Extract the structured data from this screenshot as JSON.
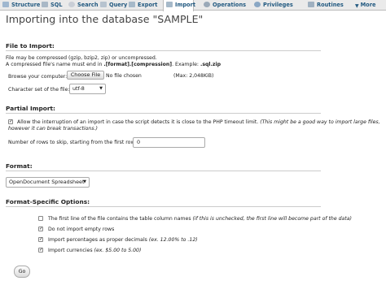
{
  "tabs": [
    {
      "label": "Structure",
      "icon": "structure-icon"
    },
    {
      "label": "SQL",
      "icon": "sql-icon"
    },
    {
      "label": "Search",
      "icon": "search-icon"
    },
    {
      "label": "Query",
      "icon": "query-icon"
    },
    {
      "label": "Export",
      "icon": "export-icon"
    },
    {
      "label": "Import",
      "icon": "import-icon"
    },
    {
      "label": "Operations",
      "icon": "operations-icon"
    },
    {
      "label": "Privileges",
      "icon": "privileges-icon"
    },
    {
      "label": "Routines",
      "icon": "routines-icon"
    },
    {
      "label": "More",
      "icon": "chevron-down-icon"
    }
  ],
  "title": "Importing into the database \"SAMPLE\"",
  "file_to_import": {
    "legend": "File to Import:",
    "line1": "File may be compressed (gzip, bzip2, zip) or uncompressed.",
    "line2_a": "A compressed file's name must end in ",
    "line2_b": ".[format].[compression]",
    "line2_c": ". Example: ",
    "line2_d": ".sql.zip",
    "browse_label": "Browse your computer:",
    "choose_file_button": "Choose File",
    "no_file_text": "No file chosen",
    "max_size": "(Max: 2,048KiB)",
    "charset_label": "Character set of the file:",
    "charset_value": "utf-8"
  },
  "partial_import": {
    "legend": "Partial Import:",
    "allow_interrupt_text": "Allow the interruption of an import in case the script detects it is close to the PHP timeout limit.",
    "allow_interrupt_note_1": "(This might be a good way to import large files,",
    "allow_interrupt_note_2": "however it can break transactions.)",
    "allow_interrupt_checked": true,
    "skip_label": "Number of rows to skip, starting from the first row:",
    "skip_value": "0"
  },
  "format": {
    "legend": "Format:",
    "value": "OpenDocument Spreadsheet"
  },
  "format_specific": {
    "legend": "Format-Specific Options:",
    "options": [
      {
        "label": "The first line of the file contains the table column names",
        "note": "(if this is unchecked, the first line will become part of the data)",
        "checked": false
      },
      {
        "label": "Do not import empty rows",
        "note": "",
        "checked": true
      },
      {
        "label": "Import percentages as proper decimals",
        "note": "(ex. 12.00% to .12)",
        "checked": true
      },
      {
        "label": "Import currencies",
        "note": "(ex. $5.00 to 5.00)",
        "checked": true
      }
    ]
  },
  "go_button": "Go",
  "colors": {
    "link": "#235a81",
    "tabbar": "#eaeaea"
  }
}
